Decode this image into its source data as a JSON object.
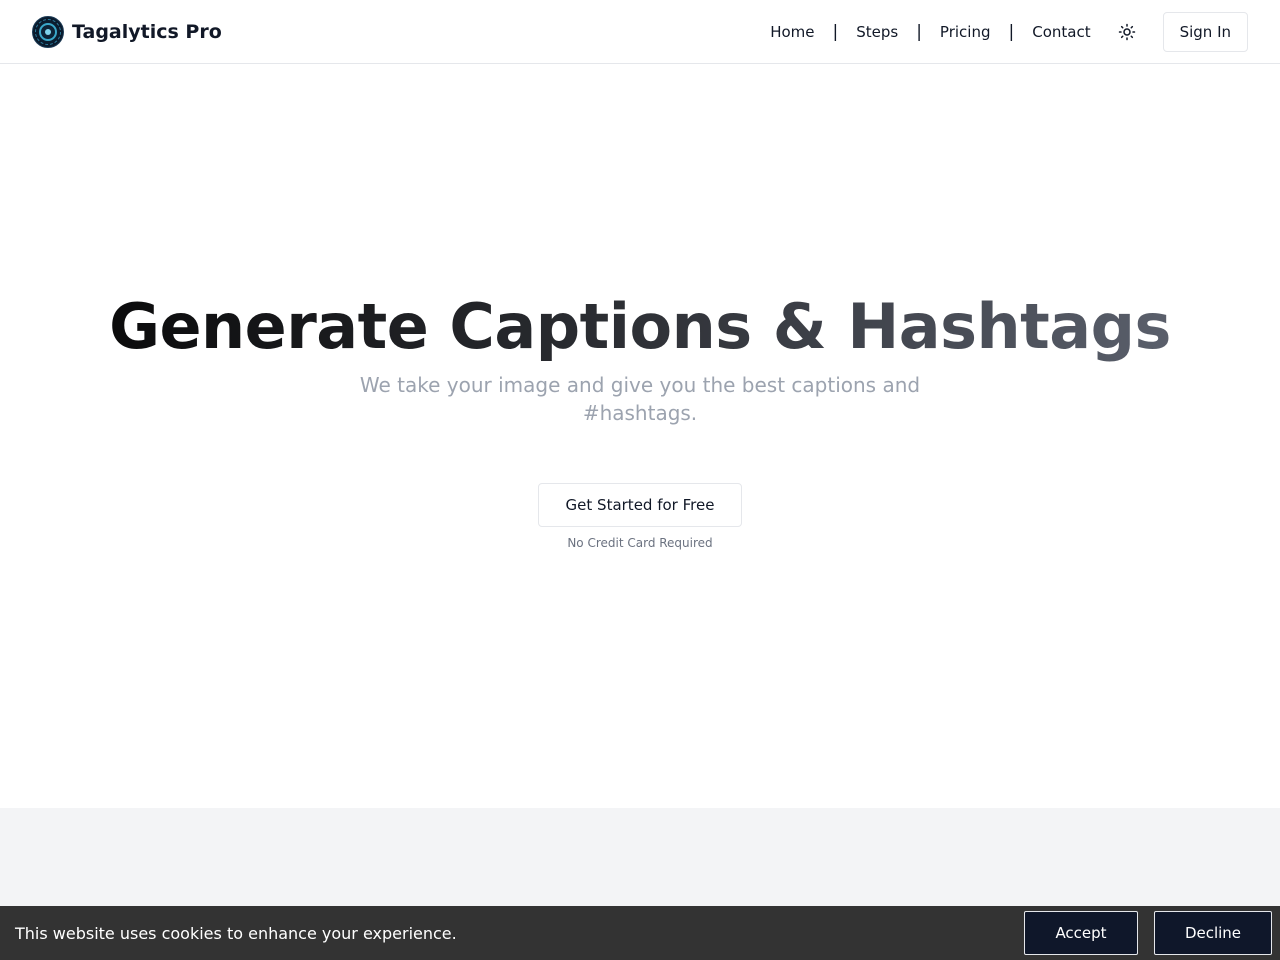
{
  "brand": {
    "name": "Tagalytics Pro",
    "logo_icon": "circuit-eye-logo"
  },
  "nav": {
    "items": [
      {
        "label": "Home"
      },
      {
        "label": "Steps"
      },
      {
        "label": "Pricing"
      },
      {
        "label": "Contact"
      }
    ],
    "separator": "|",
    "theme_icon": "sun-icon",
    "signin_label": "Sign In"
  },
  "hero": {
    "title": "Generate Captions & Hashtags",
    "subtitle": "We take your image and give you the best captions and #hashtags.",
    "cta_label": "Get Started for Free",
    "cta_note": "No Credit Card Required"
  },
  "cookie_banner": {
    "message": "This website uses cookies to enhance your experience.",
    "accept_label": "Accept",
    "decline_label": "Decline"
  },
  "colors": {
    "header_border": "#e5e7eb",
    "banner_bg": "#333333",
    "banner_button_bg": "#0f172a",
    "gray_section_bg": "#f3f4f6",
    "subtitle_text": "#9ca3af"
  }
}
